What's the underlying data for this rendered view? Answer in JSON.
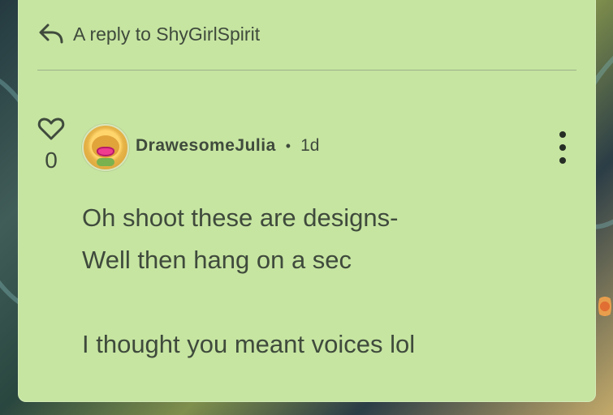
{
  "reply": {
    "text": "A reply to ShyGirlSpirit",
    "icon": "reply-arrow-icon"
  },
  "comment": {
    "like_count": "0",
    "like_icon": "heart-outline-icon",
    "avatar_icon": "lips-avatar-icon",
    "username": "DrawesomeJulia",
    "separator": "•",
    "timestamp": "1d",
    "menu_icon": "vertical-dots-icon",
    "lines": [
      "Oh shoot these are designs-",
      "Well then hang on a sec",
      "",
      "I thought you meant voices lol"
    ]
  },
  "colors": {
    "card": "#c6e5a1",
    "text": "#3f4a3c",
    "accent": "#ef3d8f"
  }
}
